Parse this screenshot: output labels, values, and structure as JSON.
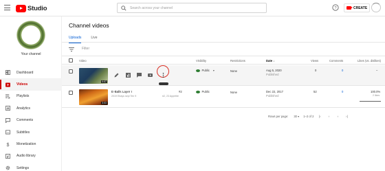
{
  "header": {
    "logo_text": "Studio",
    "search_placeholder": "Search across your channel",
    "create_label": "CREATE"
  },
  "sidebar": {
    "channel_name": "Your channel",
    "items": [
      {
        "label": "Dashboard",
        "icon": "dashboard-icon"
      },
      {
        "label": "Videos",
        "icon": "videos-icon",
        "active": true
      },
      {
        "label": "Playlists",
        "icon": "playlists-icon"
      },
      {
        "label": "Analytics",
        "icon": "analytics-icon"
      },
      {
        "label": "Comments",
        "icon": "comments-icon"
      },
      {
        "label": "Subtitles",
        "icon": "subtitles-icon"
      },
      {
        "label": "Monetization",
        "icon": "monetization-icon"
      },
      {
        "label": "Audio library",
        "icon": "audio-library-icon"
      },
      {
        "label": "Settings",
        "icon": "settings-icon"
      }
    ]
  },
  "main": {
    "title": "Channel videos",
    "tabs": [
      {
        "label": "Uploads",
        "active": true
      },
      {
        "label": "Live",
        "active": false
      }
    ],
    "filter_placeholder": "Filter",
    "columns": {
      "video": "Video",
      "visibility": "Visibility",
      "restrictions": "Restrictions",
      "date": "Date",
      "views": "Views",
      "comments": "Comments",
      "likes": "Likes (vs. dislikes)"
    },
    "rows": [
      {
        "duration": "0:07",
        "title": "",
        "description": "",
        "visibility": "Public",
        "restrictions": "None",
        "date": "Aug 5, 2020",
        "date_status": "Published",
        "views": "0",
        "comments": "0",
        "likes": "–"
      },
      {
        "duration": "3:03",
        "title": "E-Balls Layer I",
        "description": "2019 Ebays sepi Ten 9",
        "rank": "#2",
        "rank_note": "#2, 23 Appetite",
        "visibility": "Public",
        "restrictions": "None",
        "date": "Dec 22, 2017",
        "date_status": "Published",
        "views": "52",
        "comments": "0",
        "likes": "100.0%",
        "likes_detail": "2 likes"
      }
    ],
    "pagination": {
      "rows_per_page_label": "Rows per page:",
      "rows_per_page": "30",
      "range": "1–2 of 2"
    }
  },
  "colors": {
    "accent_red": "#ff0000",
    "link_blue": "#065fd4",
    "public_green": "#2e7d32"
  }
}
